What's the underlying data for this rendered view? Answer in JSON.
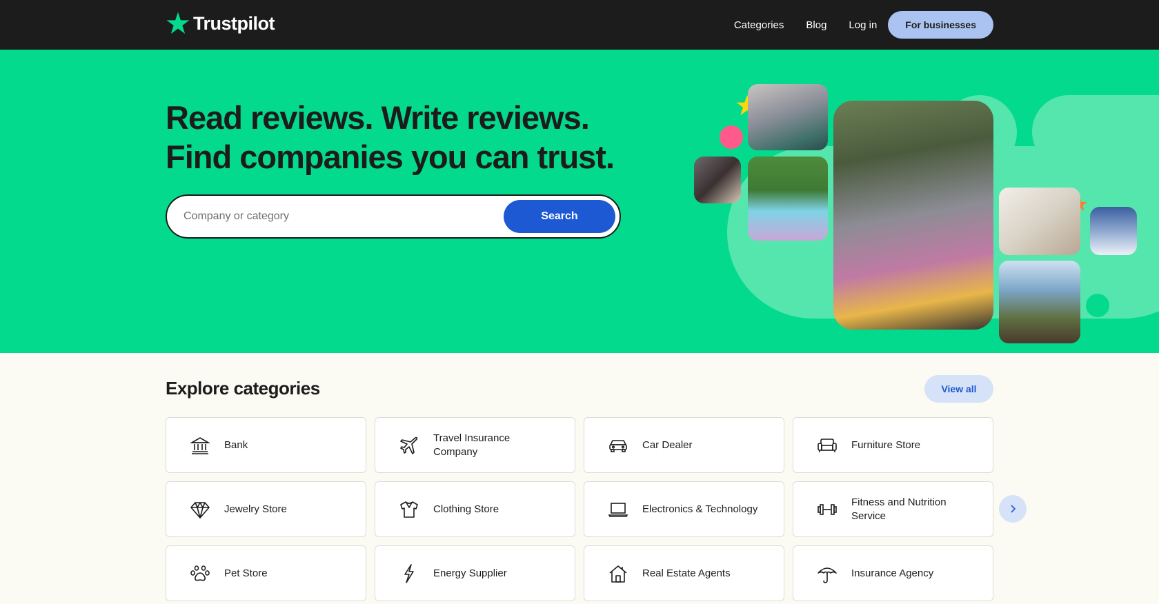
{
  "header": {
    "logo_text": "Trustpilot",
    "nav": [
      {
        "label": "Categories"
      },
      {
        "label": "Blog"
      },
      {
        "label": "Log in"
      }
    ],
    "business_button": "For businesses"
  },
  "hero": {
    "title_line1": "Read reviews. Write reviews.",
    "title_line2": "Find companies you can trust.",
    "search": {
      "placeholder": "Company or category",
      "value": "",
      "button": "Search"
    }
  },
  "categories": {
    "title": "Explore categories",
    "view_all": "View all",
    "items": [
      {
        "label": "Bank",
        "icon": "bank-icon"
      },
      {
        "label": "Travel Insurance Company",
        "icon": "airplane-icon"
      },
      {
        "label": "Car Dealer",
        "icon": "car-icon"
      },
      {
        "label": "Furniture Store",
        "icon": "sofa-icon"
      },
      {
        "label": "Jewelry Store",
        "icon": "diamond-icon"
      },
      {
        "label": "Clothing Store",
        "icon": "shirt-icon"
      },
      {
        "label": "Electronics & Technology",
        "icon": "laptop-icon"
      },
      {
        "label": "Fitness and Nutrition Service",
        "icon": "dumbbell-icon"
      },
      {
        "label": "Pet Store",
        "icon": "paw-icon"
      },
      {
        "label": "Energy Supplier",
        "icon": "lightning-icon"
      },
      {
        "label": "Real Estate Agents",
        "icon": "house-icon"
      },
      {
        "label": "Insurance Agency",
        "icon": "umbrella-icon"
      }
    ]
  },
  "colors": {
    "header_bg": "#1c1c1c",
    "hero_bg": "#04da8d",
    "brand_green": "#04da8d",
    "primary_blue": "#1c59d3",
    "business_button_bg": "#aac3f0",
    "page_bg": "#fcfbf3"
  }
}
